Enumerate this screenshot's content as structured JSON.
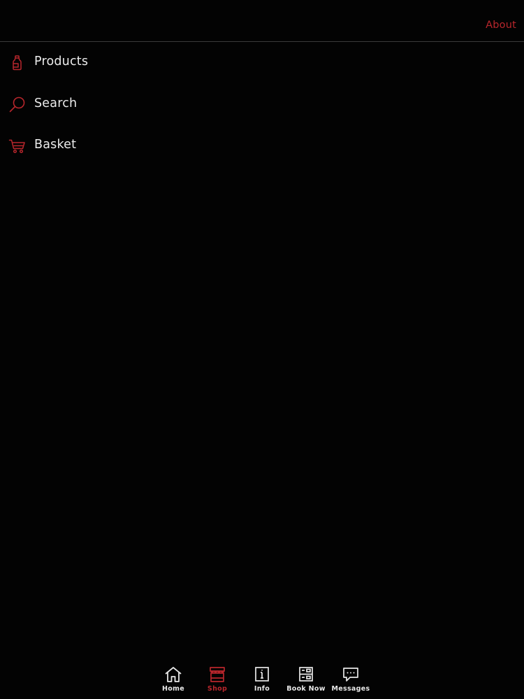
{
  "header": {
    "link_label": "About"
  },
  "menu": {
    "items": [
      {
        "label": "Products",
        "icon": "bottle-icon"
      },
      {
        "label": "Search",
        "icon": "search-icon"
      },
      {
        "label": "Basket",
        "icon": "cart-icon"
      }
    ]
  },
  "tabbar": {
    "active": "Shop",
    "tabs": [
      {
        "label": "Home",
        "icon": "home-icon"
      },
      {
        "label": "Shop",
        "icon": "shop-icon"
      },
      {
        "label": "Info",
        "icon": "info-icon"
      },
      {
        "label": "Book Now",
        "icon": "book-now-icon"
      },
      {
        "label": "Messages",
        "icon": "messages-icon"
      }
    ]
  },
  "colors": {
    "background": "#030303",
    "accent": "#b8262c",
    "text": "#ececec",
    "divider": "#3a3a3a"
  }
}
